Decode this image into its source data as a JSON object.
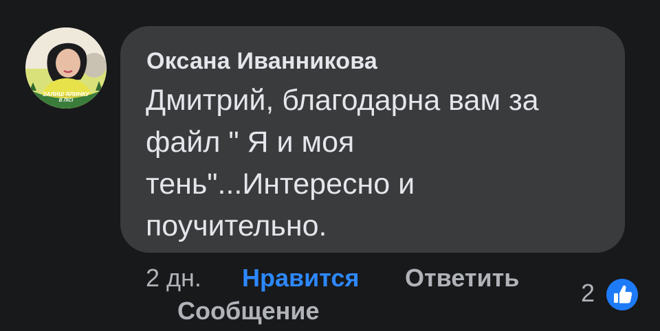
{
  "comment": {
    "author": "Оксана Иванникова",
    "text_lines": [
      "Дмитрий, благодарна вам за",
      "файл \" Я и моя",
      "тень\"...Интересно и",
      "поучительно."
    ],
    "avatar": {
      "frame_text_line1": "ЗАЛИШ ЯЛИНКУ",
      "frame_text_line2": "В ЛІСІ",
      "frame_color": "#3a7d3a"
    }
  },
  "actions": {
    "time": "2 дн.",
    "like_label": "Нравится",
    "reply_label": "Ответить",
    "message_label": "Сообщение"
  },
  "reactions": {
    "count": "2",
    "icon": "thumbs-up-icon",
    "color": "#1e7bf7"
  },
  "colors": {
    "background": "#18191a",
    "bubble": "#3a3b3c",
    "text": "#e4e6eb",
    "secondary": "#b0b3b8",
    "accent": "#2d88ff"
  }
}
